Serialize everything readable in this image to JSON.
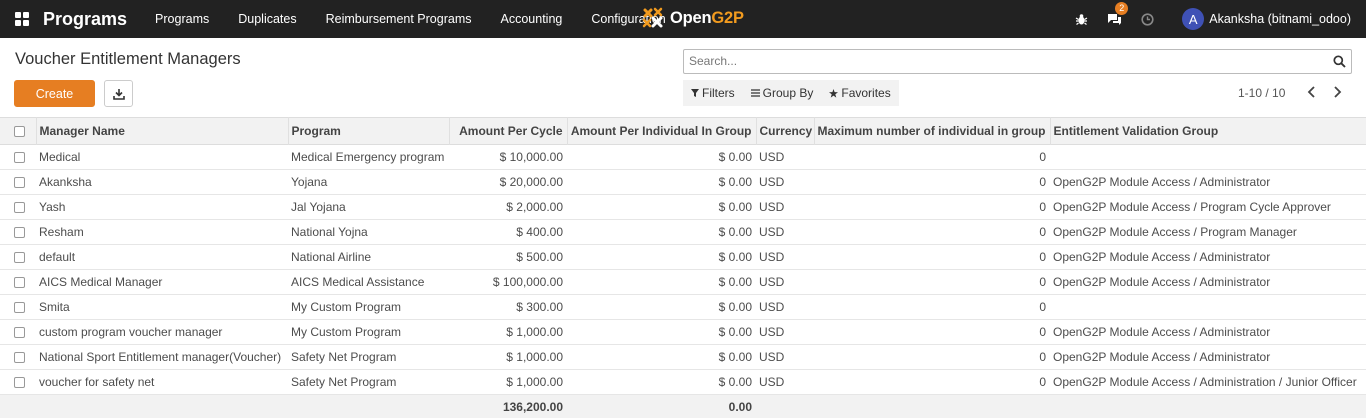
{
  "nav": {
    "app_title": "Programs",
    "menu": [
      "Programs",
      "Duplicates",
      "Reimbursement Programs",
      "Accounting",
      "Configuration"
    ],
    "logo_text_1": "Open",
    "logo_text_2": "G2P",
    "chat_badge": "2",
    "avatar_letter": "A",
    "user_name": "Akanksha (bitnami_odoo)"
  },
  "control": {
    "title": "Voucher Entitlement Managers",
    "create_label": "Create",
    "search_placeholder": "Search...",
    "filters_label": "Filters",
    "groupby_label": "Group By",
    "favorites_label": "Favorites",
    "pager": "1-10 / 10"
  },
  "table": {
    "columns": [
      "Manager Name",
      "Program",
      "Amount Per Cycle",
      "Amount Per Individual In Group",
      "Currency",
      "Maximum number of individual in group",
      "Entitlement Validation Group"
    ],
    "rows": [
      {
        "name": "Medical",
        "program": "Medical Emergency program",
        "amount_cycle": "$ 10,000.00",
        "amount_individual": "$ 0.00",
        "currency": "USD",
        "max_individual": "0",
        "validation_group": ""
      },
      {
        "name": "Akanksha",
        "program": "Yojana",
        "amount_cycle": "$ 20,000.00",
        "amount_individual": "$ 0.00",
        "currency": "USD",
        "max_individual": "0",
        "validation_group": "OpenG2P Module Access / Administrator"
      },
      {
        "name": "Yash",
        "program": "Jal Yojana",
        "amount_cycle": "$ 2,000.00",
        "amount_individual": "$ 0.00",
        "currency": "USD",
        "max_individual": "0",
        "validation_group": "OpenG2P Module Access / Program Cycle Approver"
      },
      {
        "name": "Resham",
        "program": "National Yojna",
        "amount_cycle": "$ 400.00",
        "amount_individual": "$ 0.00",
        "currency": "USD",
        "max_individual": "0",
        "validation_group": "OpenG2P Module Access / Program Manager"
      },
      {
        "name": "default",
        "program": "National Airline",
        "amount_cycle": "$ 500.00",
        "amount_individual": "$ 0.00",
        "currency": "USD",
        "max_individual": "0",
        "validation_group": "OpenG2P Module Access / Administrator"
      },
      {
        "name": "AICS Medical Manager",
        "program": "AICS Medical Assistance",
        "amount_cycle": "$ 100,000.00",
        "amount_individual": "$ 0.00",
        "currency": "USD",
        "max_individual": "0",
        "validation_group": "OpenG2P Module Access / Administrator"
      },
      {
        "name": "Smita",
        "program": "My Custom Program",
        "amount_cycle": "$ 300.00",
        "amount_individual": "$ 0.00",
        "currency": "USD",
        "max_individual": "0",
        "validation_group": ""
      },
      {
        "name": "custom program voucher manager",
        "program": "My Custom Program",
        "amount_cycle": "$ 1,000.00",
        "amount_individual": "$ 0.00",
        "currency": "USD",
        "max_individual": "0",
        "validation_group": "OpenG2P Module Access / Administrator"
      },
      {
        "name": "National Sport Entitlement manager(Voucher)",
        "program": "Safety Net Program",
        "amount_cycle": "$ 1,000.00",
        "amount_individual": "$ 0.00",
        "currency": "USD",
        "max_individual": "0",
        "validation_group": "OpenG2P Module Access / Administrator"
      },
      {
        "name": "voucher for safety net",
        "program": "Safety Net Program",
        "amount_cycle": "$ 1,000.00",
        "amount_individual": "$ 0.00",
        "currency": "USD",
        "max_individual": "0",
        "validation_group": "OpenG2P Module Access / Administration / Junior Officer"
      }
    ],
    "totals": {
      "amount_cycle": "136,200.00",
      "amount_individual": "0.00"
    }
  },
  "icons": {
    "apps": "apps-grid-icon",
    "debug": "bug-icon",
    "chat": "chat-icon",
    "activity": "clock-icon",
    "download": "download-icon",
    "search": "search-icon",
    "filter": "filter-icon",
    "groupby": "list-icon",
    "favorites": "star-icon",
    "prev": "chevron-left-icon",
    "next": "chevron-right-icon"
  },
  "colors": {
    "navbar": "#222222",
    "accent": "#e67e22",
    "logo_accent": "#f29b1f",
    "avatar": "#3f51b5"
  }
}
